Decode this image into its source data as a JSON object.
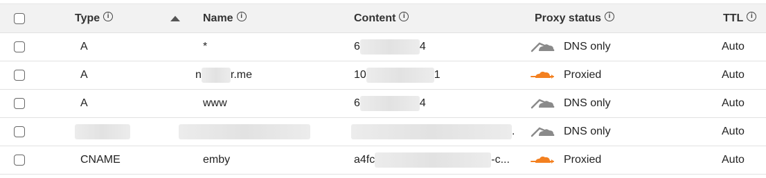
{
  "header": {
    "type": "Type",
    "name": "Name",
    "content": "Content",
    "proxy_status": "Proxy status",
    "ttl": "TTL",
    "info_glyph": "i"
  },
  "rows": [
    {
      "type": "A",
      "name": "*",
      "content_prefix": "6",
      "content_suffix": "4",
      "proxy": "DNS only",
      "proxy_mode": "dns-only",
      "ttl": "Auto"
    },
    {
      "type": "A",
      "name_prefix": "n",
      "name_suffix": "r.me",
      "content_prefix": "10",
      "content_suffix": "1",
      "proxy": "Proxied",
      "proxy_mode": "proxied",
      "ttl": "Auto"
    },
    {
      "type": "A",
      "name": "www",
      "content_prefix": "6",
      "content_suffix": "4",
      "proxy": "DNS only",
      "proxy_mode": "dns-only",
      "ttl": "Auto"
    },
    {
      "type": "",
      "name": "",
      "content_suffix": ".",
      "proxy": "DNS only",
      "proxy_mode": "dns-only",
      "ttl": "Auto"
    },
    {
      "type": "CNAME",
      "name": "emby",
      "content_prefix": "a4fc",
      "content_suffix": "-c...",
      "proxy": "Proxied",
      "proxy_mode": "proxied",
      "ttl": "Auto"
    }
  ],
  "colors": {
    "proxied": "#f38020",
    "dns_only": "#8a8a8a",
    "header_bg": "#f2f2f2"
  },
  "icons": {
    "dns_only": "grey-cloud-icon",
    "proxied": "orange-cloud-icon"
  }
}
